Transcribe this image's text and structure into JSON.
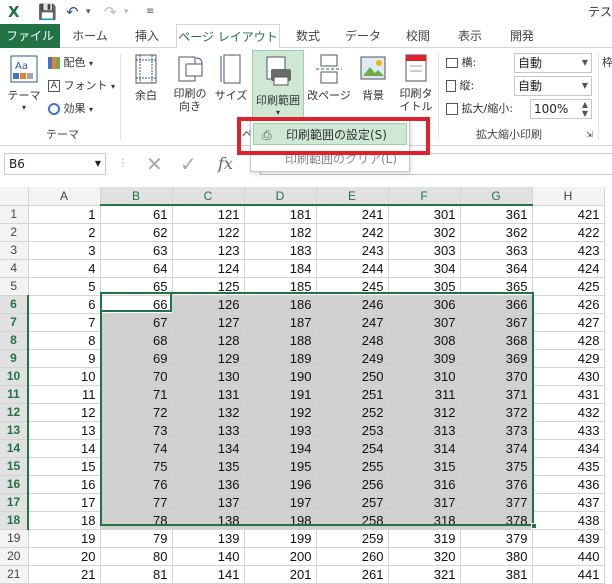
{
  "title": "テス",
  "qa_icons": [
    "excel-icon",
    "save-icon",
    "undo-icon",
    "redo-icon",
    "customize-icon"
  ],
  "tabs": [
    {
      "label": "ファイル"
    },
    {
      "label": "ホーム"
    },
    {
      "label": "挿入"
    },
    {
      "label": "ページ レイアウト"
    },
    {
      "label": "数式"
    },
    {
      "label": "データ"
    },
    {
      "label": "校閲"
    },
    {
      "label": "表示"
    },
    {
      "label": "開発"
    }
  ],
  "ribbon": {
    "theme_label": "テーマ",
    "colors_label": "配色",
    "fonts_label": "フォント",
    "effects_label": "効果",
    "group_theme": "テーマ",
    "margins_label": "余白",
    "orientation_label": "印刷の向き",
    "size_label": "サイズ",
    "print_area_label": "印刷範囲",
    "breaks_label": "改ページ",
    "background_label": "背景",
    "print_titles_label": "印刷タイトル",
    "width_label": "横:",
    "height_label": "縦:",
    "scale_label": "拡大/縮小:",
    "width_value": "自動",
    "height_value": "自動",
    "scale_value": "100%",
    "group_scale": "拡大縮小印刷",
    "right_cut": "枠"
  },
  "menu": {
    "set_print_area": "印刷範囲の設定(S)",
    "clear_print_area": "印刷範囲のクリア(L)"
  },
  "formula_bar": {
    "name_box": "B6",
    "fx": "fx"
  },
  "sheet": {
    "columns": [
      "A",
      "B",
      "C",
      "D",
      "E",
      "F",
      "G",
      "H"
    ],
    "rows": [
      {
        "n": "1",
        "cells": [
          "1",
          "61",
          "121",
          "181",
          "241",
          "301",
          "361",
          "421"
        ]
      },
      {
        "n": "2",
        "cells": [
          "2",
          "62",
          "122",
          "182",
          "242",
          "302",
          "362",
          "422"
        ]
      },
      {
        "n": "3",
        "cells": [
          "3",
          "63",
          "123",
          "183",
          "243",
          "303",
          "363",
          "423"
        ]
      },
      {
        "n": "4",
        "cells": [
          "4",
          "64",
          "124",
          "184",
          "244",
          "304",
          "364",
          "424"
        ]
      },
      {
        "n": "5",
        "cells": [
          "5",
          "65",
          "125",
          "185",
          "245",
          "305",
          "365",
          "425"
        ]
      },
      {
        "n": "6",
        "cells": [
          "6",
          "66",
          "126",
          "186",
          "246",
          "306",
          "366",
          "426"
        ]
      },
      {
        "n": "7",
        "cells": [
          "7",
          "67",
          "127",
          "187",
          "247",
          "307",
          "367",
          "427"
        ]
      },
      {
        "n": "8",
        "cells": [
          "8",
          "68",
          "128",
          "188",
          "248",
          "308",
          "368",
          "428"
        ]
      },
      {
        "n": "9",
        "cells": [
          "9",
          "69",
          "129",
          "189",
          "249",
          "309",
          "369",
          "429"
        ]
      },
      {
        "n": "10",
        "cells": [
          "10",
          "70",
          "130",
          "190",
          "250",
          "310",
          "370",
          "430"
        ]
      },
      {
        "n": "11",
        "cells": [
          "11",
          "71",
          "131",
          "191",
          "251",
          "311",
          "371",
          "431"
        ]
      },
      {
        "n": "12",
        "cells": [
          "12",
          "72",
          "132",
          "192",
          "252",
          "312",
          "372",
          "432"
        ]
      },
      {
        "n": "13",
        "cells": [
          "13",
          "73",
          "133",
          "193",
          "253",
          "313",
          "373",
          "433"
        ]
      },
      {
        "n": "14",
        "cells": [
          "14",
          "74",
          "134",
          "194",
          "254",
          "314",
          "374",
          "434"
        ]
      },
      {
        "n": "15",
        "cells": [
          "15",
          "75",
          "135",
          "195",
          "255",
          "315",
          "375",
          "435"
        ]
      },
      {
        "n": "16",
        "cells": [
          "16",
          "76",
          "136",
          "196",
          "256",
          "316",
          "376",
          "436"
        ]
      },
      {
        "n": "17",
        "cells": [
          "17",
          "77",
          "137",
          "197",
          "257",
          "317",
          "377",
          "437"
        ]
      },
      {
        "n": "18",
        "cells": [
          "18",
          "78",
          "138",
          "198",
          "258",
          "318",
          "378",
          "438"
        ]
      },
      {
        "n": "19",
        "cells": [
          "19",
          "79",
          "139",
          "199",
          "259",
          "319",
          "379",
          "439"
        ]
      },
      {
        "n": "20",
        "cells": [
          "20",
          "80",
          "140",
          "200",
          "260",
          "320",
          "380",
          "440"
        ]
      },
      {
        "n": "21",
        "cells": [
          "21",
          "81",
          "141",
          "201",
          "261",
          "321",
          "381",
          "441"
        ]
      }
    ],
    "selected_columns": [
      "B",
      "C",
      "D",
      "E",
      "F",
      "G"
    ],
    "selected_rows": [
      "6",
      "7",
      "8",
      "9",
      "10",
      "11",
      "12",
      "13",
      "14",
      "15",
      "16",
      "17",
      "18"
    ],
    "active_cell": "B6"
  },
  "colors": {
    "accent": "#217346",
    "highlight_box": "#e0212b",
    "selection_fill": "#d0d0d0"
  }
}
